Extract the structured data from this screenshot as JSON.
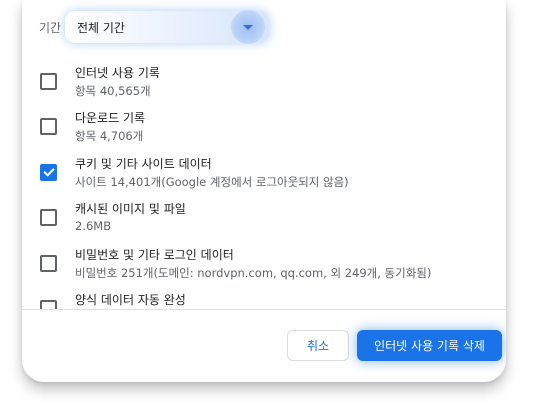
{
  "period": {
    "label": "기간",
    "selected": "전체 기간"
  },
  "items": [
    {
      "title": "인터넷 사용 기록",
      "subtitle": "항목 40,565개",
      "checked": false
    },
    {
      "title": "다운로드 기록",
      "subtitle": "항목 4,706개",
      "checked": false
    },
    {
      "title": "쿠키 및 기타 사이트 데이터",
      "subtitle": "사이트 14,401개(Google 계정에서 로그아웃되지 않음)",
      "checked": true
    },
    {
      "title": "캐시된 이미지 및 파일",
      "subtitle": "2.6MB",
      "checked": false
    },
    {
      "title": "비밀번호 및 기타 로그인 데이터",
      "subtitle": "비밀번호 251개(도메인: nordvpn.com, qq.com, 외 249개, 동기화됨)",
      "checked": false
    },
    {
      "title": "양식 데이터 자동 완성",
      "subtitle": "",
      "checked": false
    }
  ],
  "buttons": {
    "cancel": "취소",
    "delete": "인터넷 사용 기록 삭제"
  },
  "colors": {
    "accent": "#1a73e8"
  }
}
